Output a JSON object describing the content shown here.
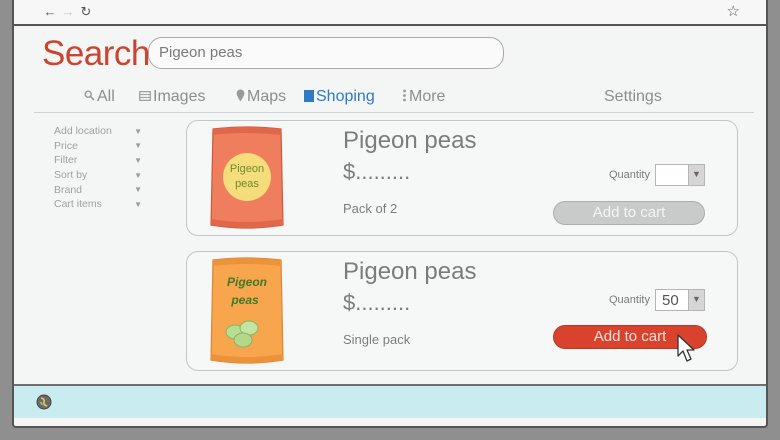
{
  "search": {
    "logo": "Search",
    "query": "Pigeon peas"
  },
  "tabs": [
    {
      "label": "All",
      "icon": "search-icon"
    },
    {
      "label": "Images",
      "icon": "image-icon"
    },
    {
      "label": "Maps",
      "icon": "map-pin-icon"
    },
    {
      "label": "Shoping",
      "icon": "shopping-icon",
      "active": true
    },
    {
      "label": "More",
      "icon": "more-icon"
    }
  ],
  "settings_label": "Settings",
  "filters": [
    {
      "label": "Add location"
    },
    {
      "label": "Price"
    },
    {
      "label": "Filter"
    },
    {
      "label": "Sort by"
    },
    {
      "label": "Brand"
    },
    {
      "label": "Cart items"
    }
  ],
  "results": [
    {
      "title": "Pigeon peas",
      "price": "$.........",
      "pack": "Pack of 2",
      "package_text": "Pigeon peas",
      "quantity_label": "Quantity",
      "quantity_value": "",
      "cart_label": "Add to cart",
      "cart_enabled": false
    },
    {
      "title": "Pigeon peas",
      "price": "$.........",
      "pack": "Single pack",
      "package_text": "Pigeon peas",
      "quantity_label": "Quantity",
      "quantity_value": "50",
      "cart_label": "Add to cart",
      "cart_enabled": true
    }
  ],
  "colors": {
    "logo": "#cc4330",
    "active_tab": "#2f7ac2",
    "cart_button": "#d9432e",
    "statusbar": "#c9ecf1"
  }
}
